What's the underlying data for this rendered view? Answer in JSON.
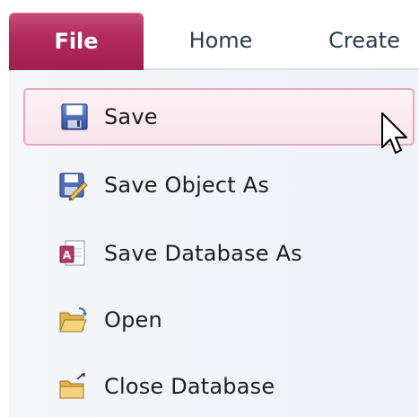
{
  "ribbon": {
    "tabs": [
      {
        "label": "File",
        "active": true
      },
      {
        "label": "Home",
        "active": false
      },
      {
        "label": "Create",
        "active": false
      }
    ],
    "accent_color": "#b02a5b"
  },
  "backstage_menu": {
    "items": [
      {
        "label": "Save",
        "icon": "floppy-disk-icon",
        "hovered": true
      },
      {
        "label": "Save Object As",
        "icon": "save-object-as-icon",
        "hovered": false
      },
      {
        "label": "Save Database As",
        "icon": "save-database-as-icon",
        "hovered": false
      },
      {
        "label": "Open",
        "icon": "open-folder-icon",
        "hovered": false
      },
      {
        "label": "Close Database",
        "icon": "close-database-folder-icon",
        "hovered": false
      }
    ]
  },
  "pointer": {
    "icon": "mouse-pointer-icon"
  }
}
